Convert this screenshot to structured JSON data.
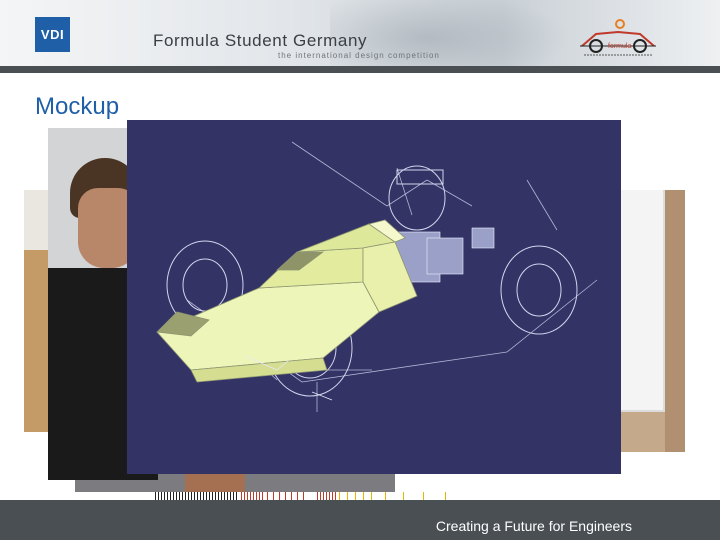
{
  "header": {
    "vdi_logo_text": "VDI",
    "title": "Formula Student Germany",
    "subtitle": "the international design competition",
    "event_logo_text": "formula"
  },
  "slide": {
    "title": "Mockup"
  },
  "footer": {
    "tagline": "Creating a Future for Engineers"
  },
  "colors": {
    "title_blue": "#1f5fa8",
    "cad_background": "#333366",
    "cad_body": "#eef5b8",
    "bar_dark": "#4a4f54"
  }
}
